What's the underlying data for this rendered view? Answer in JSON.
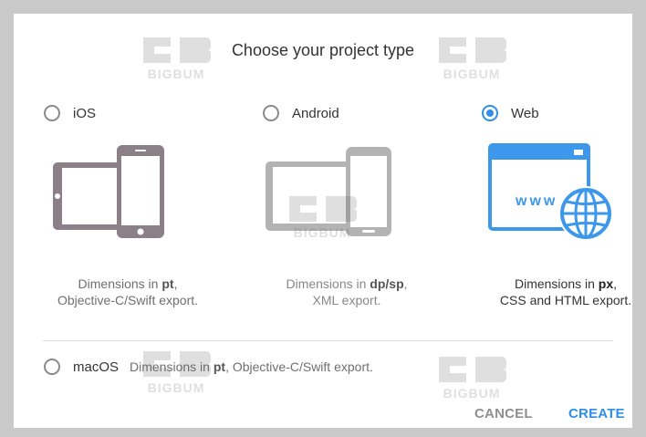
{
  "dialog": {
    "title": "Choose your project type"
  },
  "options": {
    "ios": {
      "label": "iOS",
      "selected": false,
      "desc_prefix": "Dimensions in ",
      "desc_unit": "pt",
      "desc_suffix": ",",
      "desc_line2": "Objective-C/Swift export.",
      "icon": "tablet-phone-icon"
    },
    "android": {
      "label": "Android",
      "selected": false,
      "desc_prefix": "Dimensions in ",
      "desc_unit": "dp/sp",
      "desc_suffix": ",",
      "desc_line2": "XML export.",
      "icon": "android-devices-icon"
    },
    "web": {
      "label": "Web",
      "selected": true,
      "desc_prefix": "Dimensions in ",
      "desc_unit": "px",
      "desc_suffix": ",",
      "desc_line2": "CSS and HTML export.",
      "icon": "browser-globe-icon",
      "www_text": "www"
    },
    "macos": {
      "label": "macOS",
      "selected": false,
      "desc_prefix": "Dimensions in ",
      "desc_unit": "pt",
      "desc_suffix": ", Objective-C/Swift export."
    }
  },
  "buttons": {
    "cancel": "CANCEL",
    "create": "CREATE"
  },
  "watermark": {
    "text": "BIGBUM"
  },
  "colors": {
    "accent": "#2f8ee8",
    "ios_device": "#8b8088",
    "android_device": "#b3b3b3",
    "web_icon": "#3d97ea"
  }
}
